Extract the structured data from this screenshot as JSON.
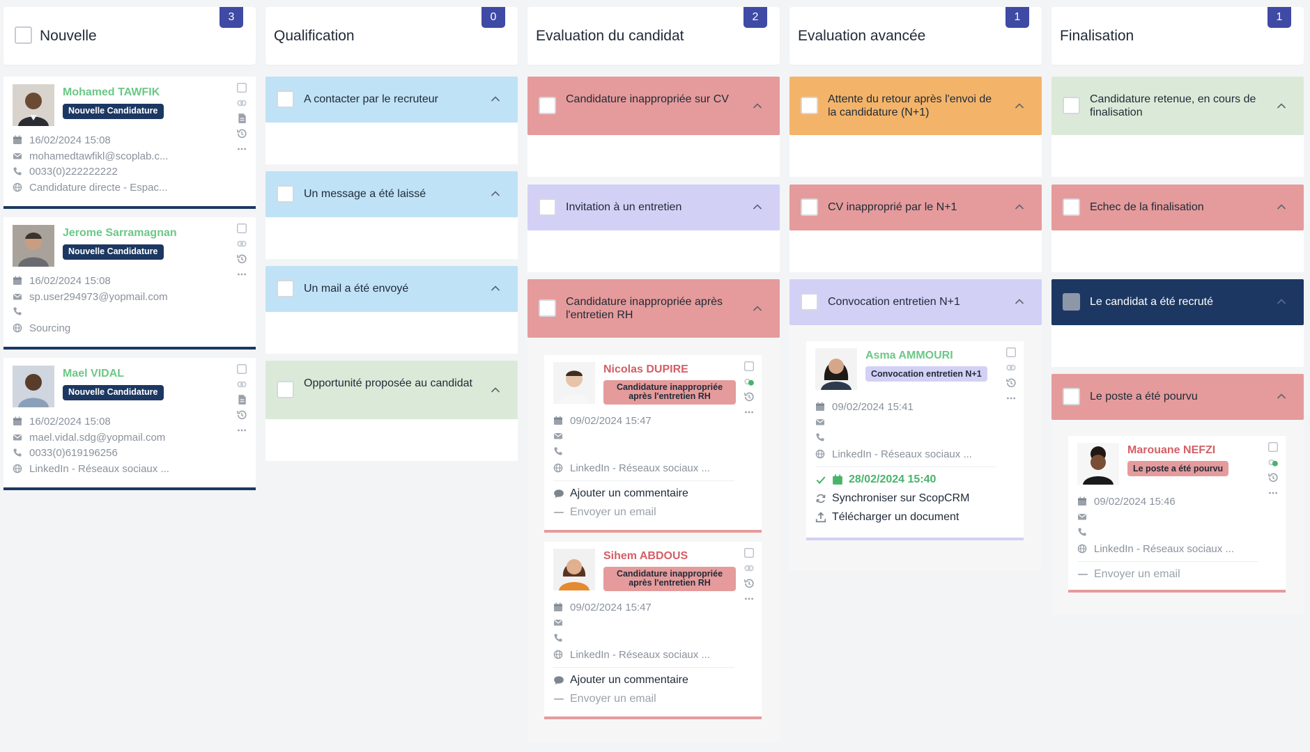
{
  "columns": [
    {
      "title": "Nouvelle",
      "count": "3"
    },
    {
      "title": "Qualification",
      "count": "0"
    },
    {
      "title": "Evaluation du candidat",
      "count": "2"
    },
    {
      "title": "Evaluation avancée",
      "count": "1"
    },
    {
      "title": "Finalisation",
      "count": "1"
    }
  ],
  "groups": {
    "qualification": [
      {
        "label": "A contacter par le recruteur"
      },
      {
        "label": "Un message a été laissé"
      },
      {
        "label": "Un mail a été envoyé"
      },
      {
        "label": "Opportunité proposée au candidat"
      }
    ],
    "evaluation": [
      {
        "label": "Candidature inappropriée sur CV"
      },
      {
        "label": "Invitation à un entretien"
      },
      {
        "label": "Candidature inappropriée après l'entretien RH"
      }
    ],
    "avancee": [
      {
        "label": "Attente du retour après l'envoi de la candidature (N+1)"
      },
      {
        "label": "CV inapproprié par le N+1"
      },
      {
        "label": "Convocation entretien N+1"
      }
    ],
    "finalisation": [
      {
        "label": "Candidature retenue, en cours de finalisation"
      },
      {
        "label": "Echec de la finalisation"
      },
      {
        "label": "Le candidat a été recruté"
      },
      {
        "label": "Le poste a été pourvu"
      }
    ]
  },
  "cards": {
    "nouvelle": [
      {
        "name": "Mohamed TAWFIK",
        "status": "Nouvelle Candidature",
        "date": "16/02/2024 15:08",
        "email": "mohamedtawfikl@scoplab.c...",
        "phone": "0033(0)222222222",
        "source": "Candidature directe - Espac..."
      },
      {
        "name": "Jerome Sarramagnan",
        "status": "Nouvelle Candidature",
        "date": "16/02/2024 15:08",
        "email": "sp.user294973@yopmail.com",
        "phone": "",
        "source": "Sourcing"
      },
      {
        "name": "Mael VIDAL",
        "status": "Nouvelle Candidature",
        "date": "16/02/2024 15:08",
        "email": "mael.vidal.sdg@yopmail.com",
        "phone": "0033(0)619196256",
        "source": "LinkedIn - Réseaux sociaux ..."
      }
    ],
    "evaluation": [
      {
        "name": "Nicolas DUPIRE",
        "status": "Candidature inappropriée après l'entretien RH",
        "date": "09/02/2024 15:47",
        "source": "LinkedIn - Réseaux sociaux ...",
        "comment": "Ajouter un commentaire",
        "email_action": "Envoyer un email"
      },
      {
        "name": "Sihem ABDOUS",
        "status": "Candidature inappropriée après l'entretien RH",
        "date": "09/02/2024 15:47",
        "source": "LinkedIn - Réseaux sociaux ...",
        "comment": "Ajouter un commentaire",
        "email_action": "Envoyer un email"
      }
    ],
    "avancee": [
      {
        "name": "Asma AMMOURI",
        "status": "Convocation entretien N+1",
        "date": "09/02/2024 15:41",
        "source": "LinkedIn - Réseaux sociaux ...",
        "task_date": "28/02/2024 15:40",
        "sync": "Synchroniser sur ScopCRM",
        "upload": "Télécharger un document"
      }
    ],
    "finalisation": [
      {
        "name": "Marouane NEFZI",
        "status": "Le poste a été pourvu",
        "date": "09/02/2024 15:46",
        "source": "LinkedIn - Réseaux sociaux ...",
        "email_action": "Envoyer un email"
      }
    ]
  },
  "colors": {
    "accent": "#3f4aa5",
    "navy": "#1c3862",
    "blue_group": "#bfe2f6",
    "red_group": "#e59b9b",
    "purple_group": "#d3d0f6",
    "orange_group": "#f3b46a",
    "green_group": "#dbead8",
    "name_green": "#6cc787",
    "name_red": "#d45e66"
  },
  "icons": [
    "calendar-icon",
    "mail-icon",
    "phone-icon",
    "globe-icon",
    "comment-icon",
    "checkbox-icon",
    "history-icon",
    "more-icon",
    "document-icon",
    "sync-icon",
    "upload-icon",
    "chevron-up-icon",
    "link-icon"
  ]
}
